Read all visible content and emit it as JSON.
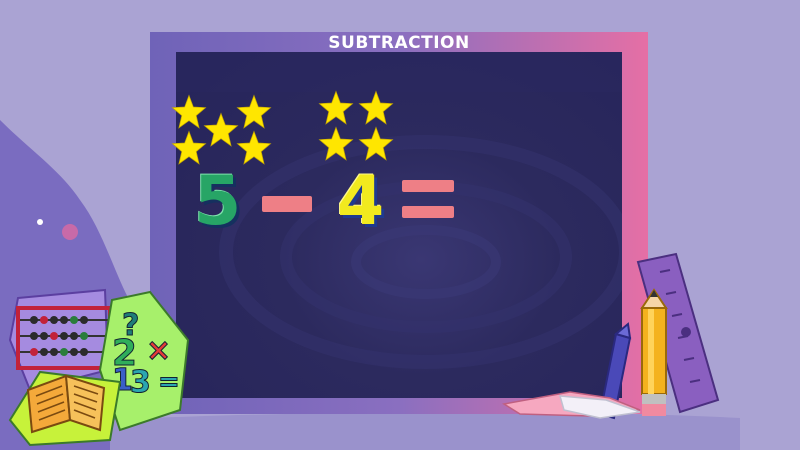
{
  "lesson": {
    "title": "SUBTRACTION",
    "equation": {
      "first_number": "5",
      "operator": "minus",
      "second_number": "4",
      "equals": "equals",
      "answer": ""
    },
    "left_star_count": 5,
    "right_star_count": 4
  },
  "colors": {
    "background": "#aaa3d3",
    "board": "#2c2a5e",
    "frame_left": "#6f63b8",
    "frame_right": "#e56fa5",
    "star": "#ffe600",
    "first_number": "#27a566",
    "second_number": "#f2ea1e",
    "operator": "#ee7f86"
  },
  "decorations": {
    "abacus_icon": "abacus-icon",
    "book_icon": "book-icon",
    "math_symbols_icon": "math-symbols-icon",
    "ruler_icon": "ruler-icon",
    "pencil_icon": "pencil-icon",
    "crayon_icon": "crayon-icon",
    "eraser_icon": "eraser-icon"
  },
  "decoration_text": {
    "math_symbols": [
      "?",
      "2",
      "×",
      "1",
      "3",
      "="
    ]
  }
}
